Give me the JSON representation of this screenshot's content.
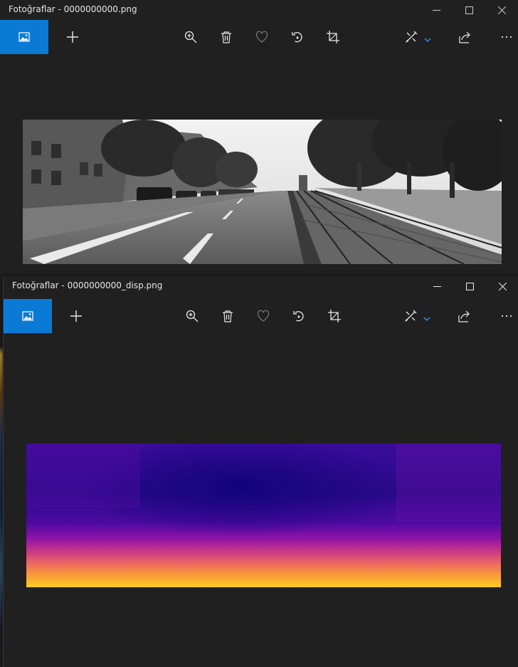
{
  "windows": [
    {
      "title": "Fotoğraflar - 0000000000.png",
      "image_description": "grayscale street scene"
    },
    {
      "title": "Fotoğraflar - 0000000000_disp.png",
      "image_description": "disparity map with plasma colormap"
    }
  ],
  "icons": {
    "gallery": "image-icon",
    "add": "plus-icon",
    "zoom": "zoom-in-icon",
    "delete": "trash-icon",
    "favorite": "heart-icon",
    "rotate": "rotate-icon",
    "crop": "crop-icon",
    "edit": "edit-tools-icon",
    "share": "share-icon",
    "more": "more-icon"
  },
  "colors": {
    "accent": "#0a7ad4",
    "background": "#202020"
  }
}
